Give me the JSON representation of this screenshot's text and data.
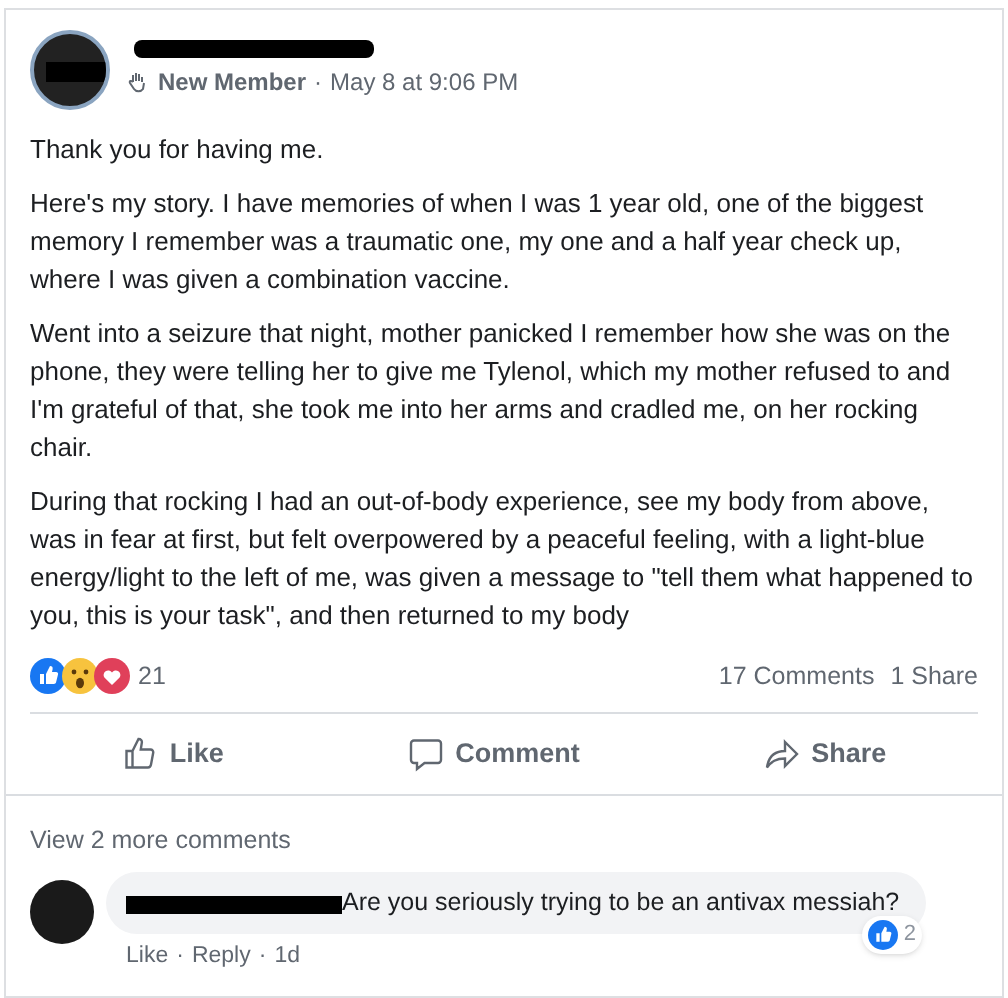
{
  "post": {
    "badge": "New Member",
    "separator": "·",
    "timestamp": "May 8 at 9:06 PM",
    "paragraphs": [
      "Thank you for having me.",
      "Here's my story. I have memories of when I was 1 year old, one of the biggest memory I remember was a traumatic one, my one and a half year check up, where I was given a combination vaccine.",
      "Went into a seizure that night, mother panicked I remember how she was on the phone, they were telling her to give me Tylenol, which my mother refused to and I'm grateful of that, she took me into her arms and cradled me, on her rocking chair.",
      "During that rocking I had an out-of-body experience, see my body from above, was in fear at first, but felt overpowered by a peaceful feeling, with a light-blue energy/light to the left of me, was given a message to \"tell them what happened to you, this is your task\", and then returned to my body"
    ],
    "reaction_count": "21",
    "comments_count": "17 Comments",
    "shares_count": "1 Share"
  },
  "actions": [
    {
      "kind": "like",
      "label": "Like"
    },
    {
      "kind": "comment",
      "label": "Comment"
    },
    {
      "kind": "share",
      "label": "Share"
    }
  ],
  "view_more": "View 2 more comments",
  "comment": {
    "text": "Are you seriously trying to be an antivax messiah?",
    "like_count": "2",
    "links": [
      "Like",
      "Reply"
    ],
    "separator": "·",
    "age": "1d"
  }
}
